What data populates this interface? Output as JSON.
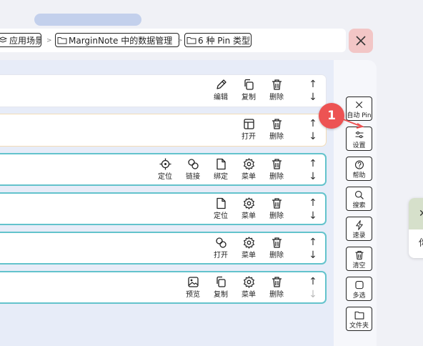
{
  "breadcrumb": {
    "items": [
      {
        "label": "应用场景",
        "prefix_icon": "stack-icon"
      },
      {
        "label": "MarginNote 中的数据管理",
        "prefix_icon": "folder-icon"
      },
      {
        "label": "6 种 Pin 类型",
        "prefix_icon": "folder-icon"
      }
    ],
    "separator": ">"
  },
  "close_button": {
    "icon": "close-icon"
  },
  "cards": [
    {
      "style": "plain",
      "actions": [
        {
          "id": "edit",
          "label": "编辑",
          "icon": "pencil-icon"
        },
        {
          "id": "copy",
          "label": "复制",
          "icon": "copy-icon"
        },
        {
          "id": "delete",
          "label": "删除",
          "icon": "trash-icon"
        }
      ]
    },
    {
      "style": "peach",
      "actions": [
        {
          "id": "open",
          "label": "打开",
          "icon": "window-icon"
        },
        {
          "id": "delete",
          "label": "删除",
          "icon": "trash-icon"
        }
      ]
    },
    {
      "style": "teal",
      "actions": [
        {
          "id": "locate",
          "label": "定位",
          "icon": "crosshair-icon"
        },
        {
          "id": "link",
          "label": "链接",
          "icon": "link-icon"
        },
        {
          "id": "bind",
          "label": "绑定",
          "icon": "document-icon"
        },
        {
          "id": "menu",
          "label": "菜单",
          "icon": "gear-icon"
        },
        {
          "id": "delete",
          "label": "删除",
          "icon": "trash-icon"
        }
      ]
    },
    {
      "style": "teal",
      "actions": [
        {
          "id": "locate",
          "label": "定位",
          "icon": "document-icon"
        },
        {
          "id": "menu",
          "label": "菜单",
          "icon": "gear-icon"
        },
        {
          "id": "delete",
          "label": "删除",
          "icon": "trash-icon"
        }
      ]
    },
    {
      "style": "teal",
      "actions": [
        {
          "id": "open",
          "label": "打开",
          "icon": "link-icon"
        },
        {
          "id": "menu",
          "label": "菜单",
          "icon": "gear-icon"
        },
        {
          "id": "delete",
          "label": "删除",
          "icon": "trash-icon"
        }
      ]
    },
    {
      "style": "teal",
      "actions": [
        {
          "id": "preview",
          "label": "预览",
          "icon": "image-icon"
        },
        {
          "id": "copy",
          "label": "复制",
          "icon": "copy-icon"
        },
        {
          "id": "menu",
          "label": "菜单",
          "icon": "gear-icon"
        },
        {
          "id": "delete",
          "label": "删除",
          "icon": "trash-icon"
        }
      ],
      "down_disabled": true
    }
  ],
  "sidebar": {
    "items": [
      {
        "label": "自动 Pin",
        "icon": "close-icon"
      },
      {
        "label": "设置",
        "icon": "sliders-icon"
      },
      {
        "label": "帮助",
        "icon": "help-icon"
      },
      {
        "label": "搜索",
        "icon": "search-icon"
      },
      {
        "label": "速录",
        "icon": "bolt-icon"
      },
      {
        "label": "清空",
        "icon": "trash-icon"
      },
      {
        "label": "多选",
        "icon": "square-icon"
      },
      {
        "label": "文件夹",
        "icon": "folder-icon"
      }
    ]
  },
  "badge": {
    "text": "1",
    "color": "#ed5353"
  },
  "colors": {
    "accent_teal": "#63c3cc",
    "peach_border": "#f3dcb6",
    "close_bg": "#f2c6c6",
    "top_pill": "#c3d0ec"
  },
  "peek_panel": {
    "close_glyph": "✕",
    "text": "你"
  }
}
